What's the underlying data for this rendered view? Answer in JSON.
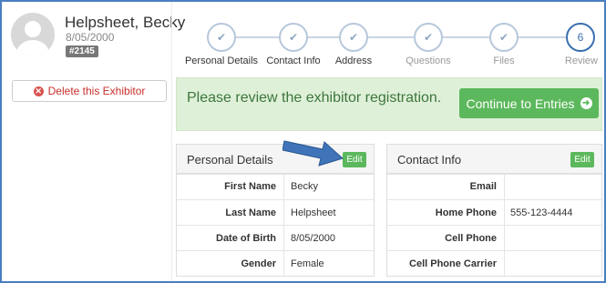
{
  "profile": {
    "name": "Helpsheet, Becky",
    "dob": "8/05/2000",
    "id": "#2145"
  },
  "delete_label": "Delete this Exhibitor",
  "steps": [
    {
      "label": "Personal Details",
      "state": "done"
    },
    {
      "label": "Contact Info",
      "state": "done"
    },
    {
      "label": "Address",
      "state": "done"
    },
    {
      "label": "Questions",
      "state": "done"
    },
    {
      "label": "Files",
      "state": "done"
    },
    {
      "label": "Review",
      "number": "6",
      "state": "current"
    }
  ],
  "alert": {
    "text": "Please review the exhibitor registration.",
    "button": "Continue to Entries"
  },
  "personal": {
    "title": "Personal Details",
    "edit": "Edit",
    "rows": [
      {
        "label": "First Name",
        "value": "Becky"
      },
      {
        "label": "Last Name",
        "value": "Helpsheet"
      },
      {
        "label": "Date of Birth",
        "value": "8/05/2000"
      },
      {
        "label": "Gender",
        "value": "Female"
      }
    ]
  },
  "contact": {
    "title": "Contact Info",
    "edit": "Edit",
    "rows": [
      {
        "label": "Email",
        "value": ""
      },
      {
        "label": "Home Phone",
        "value": "555-123-4444"
      },
      {
        "label": "Cell Phone",
        "value": ""
      },
      {
        "label": "Cell Phone Carrier",
        "value": ""
      }
    ]
  },
  "colors": {
    "accent": "#3a6fb0",
    "success": "#5cb85c",
    "alert_bg": "#dff0d8",
    "danger": "#d9534f"
  }
}
